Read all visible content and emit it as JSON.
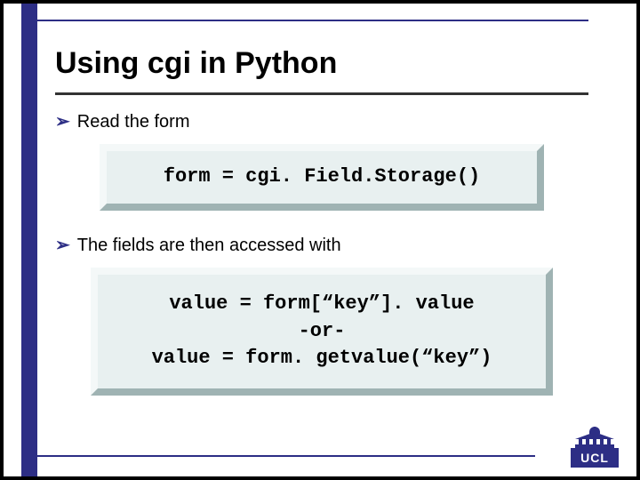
{
  "title": "Using cgi in Python",
  "bullets": [
    "Read the form",
    "The fields are then accessed with"
  ],
  "code_blocks": [
    "form = cgi. Field.Storage()",
    "value = form[“key”]. value\n-or-\nvalue = form. getvalue(“key”)"
  ],
  "logo_text": "UCL"
}
